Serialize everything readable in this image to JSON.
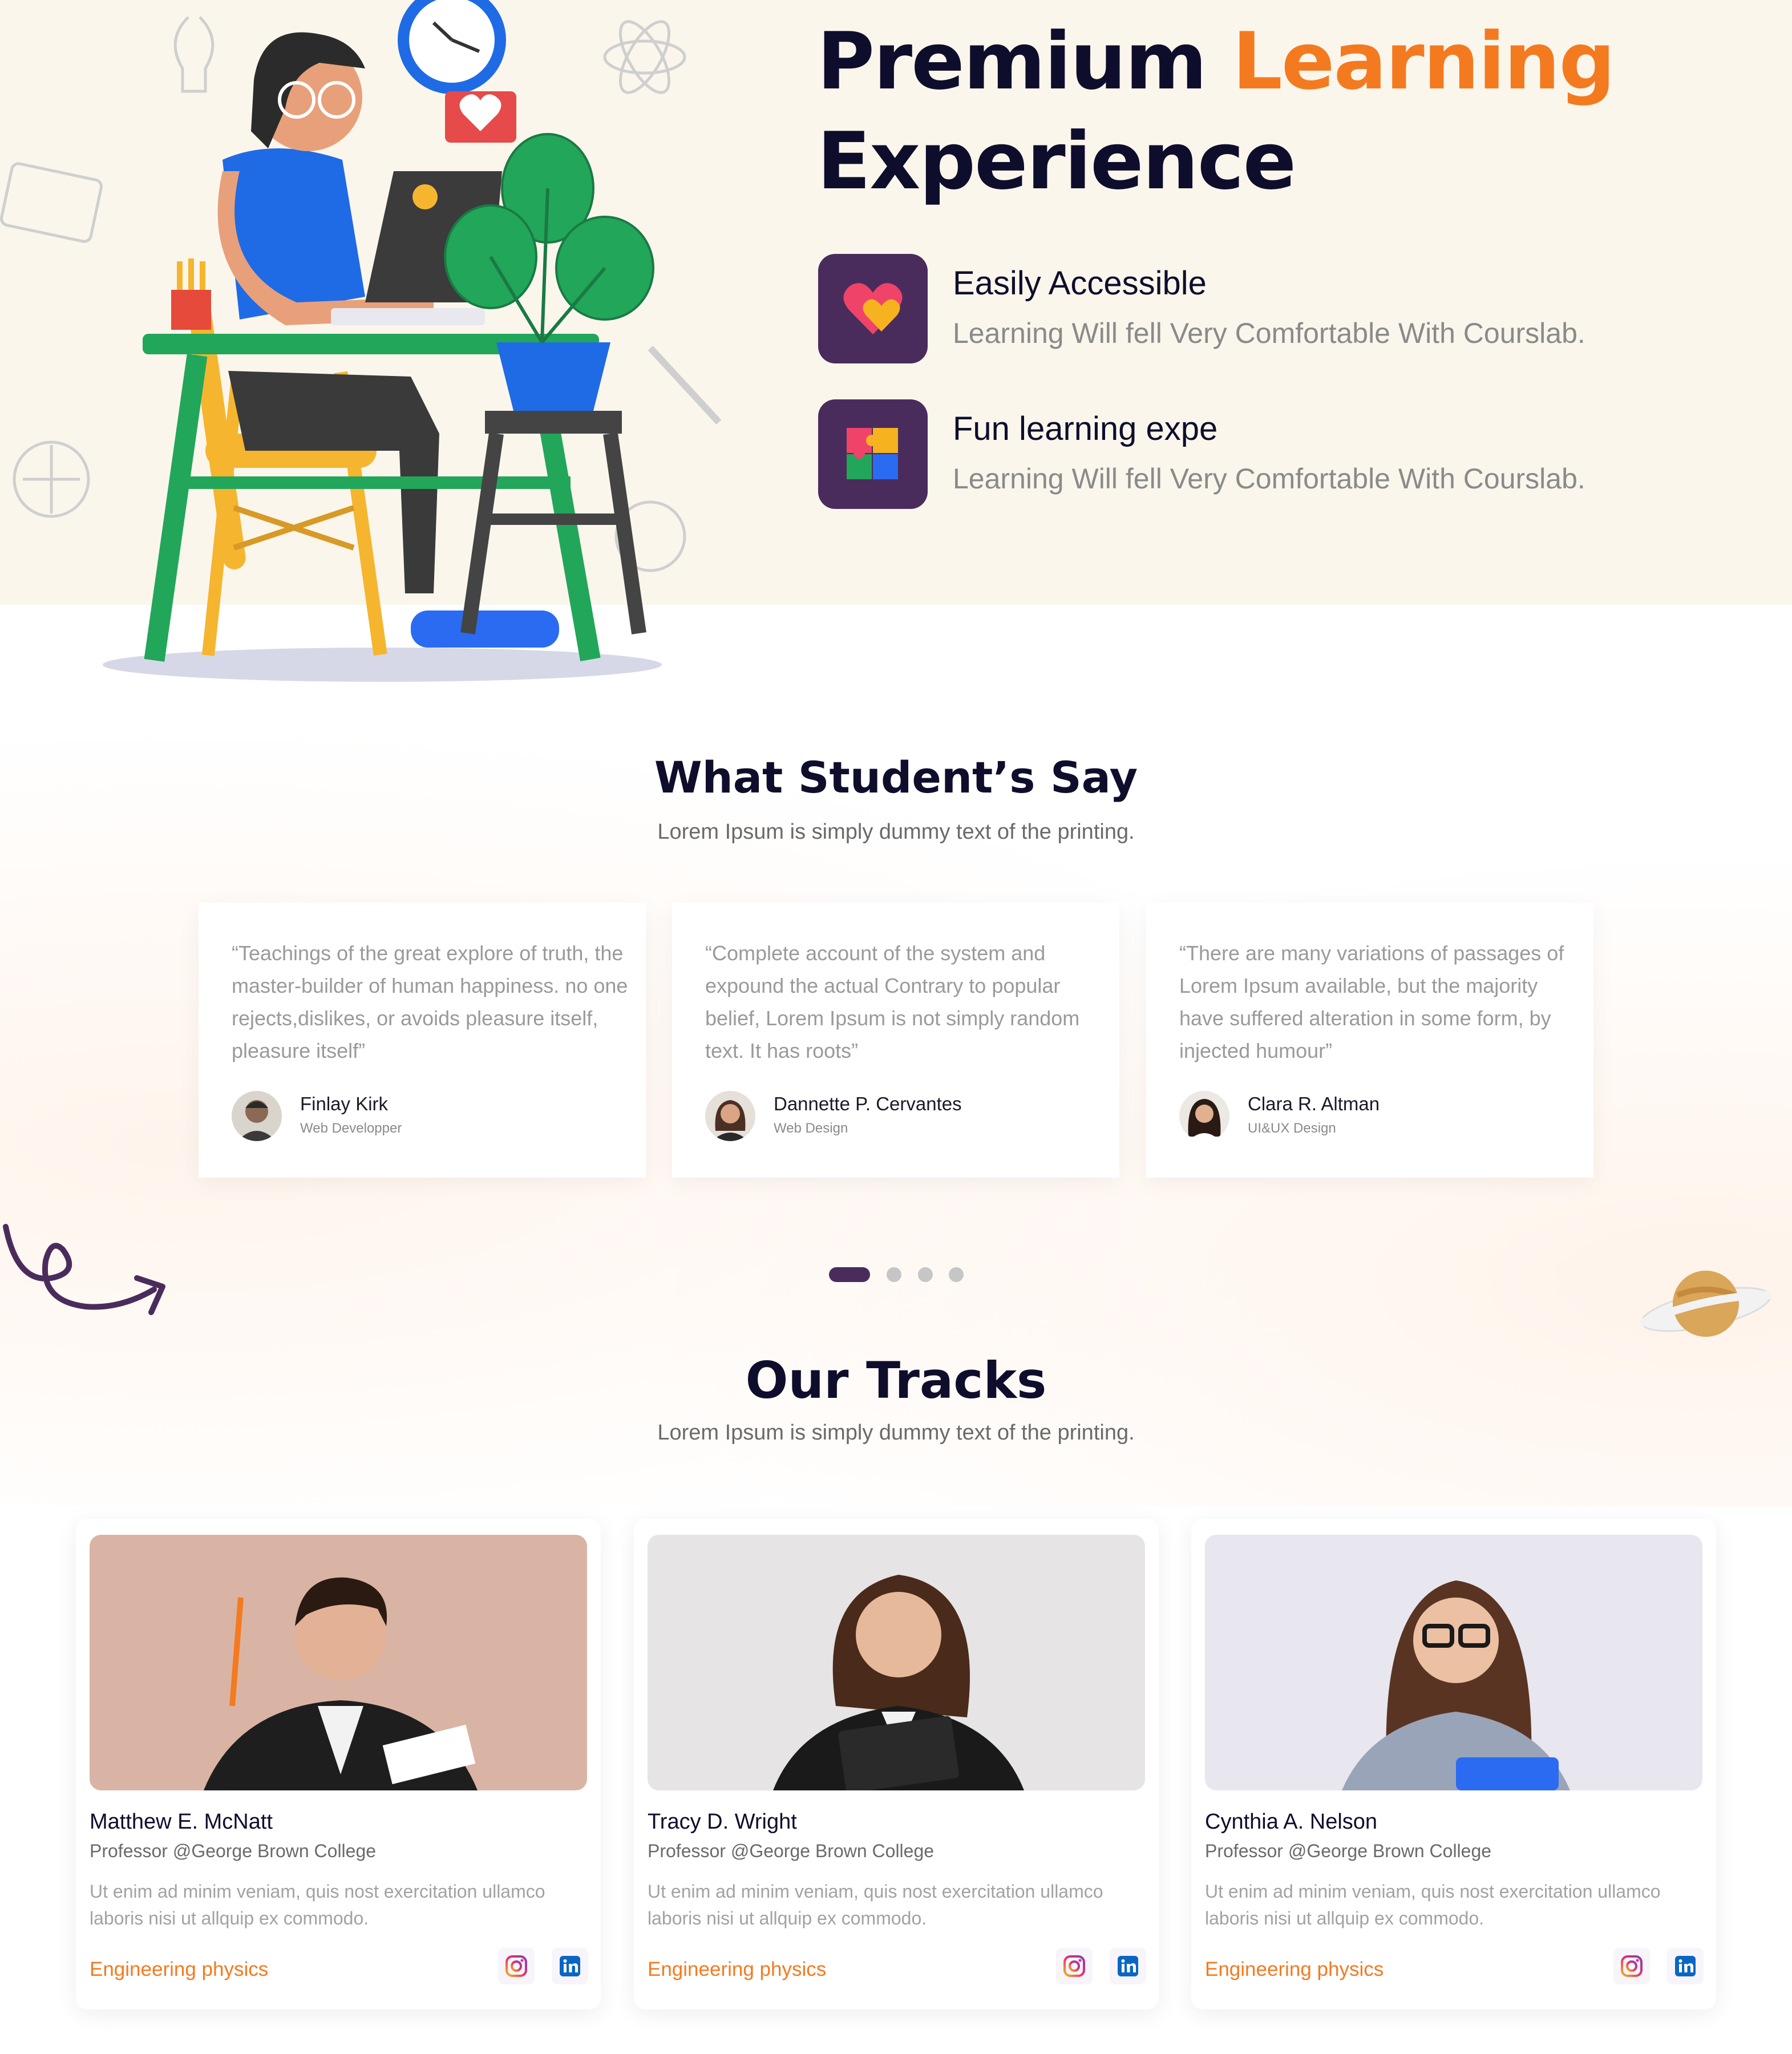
{
  "hero": {
    "title_part1": "Premium ",
    "title_accent": "Learning",
    "title_part2": "Experience",
    "features": [
      {
        "icon": "heart-icon",
        "title": "Easily Accessible",
        "description": "Learning Will fell Very Comfortable With Courslab."
      },
      {
        "icon": "puzzle-icon",
        "title": "Fun learning expe",
        "description": "Learning Will fell Very Comfortable With Courslab."
      }
    ]
  },
  "testimonials": {
    "title": "What Student’s Say",
    "subtitle": "Lorem Ipsum is simply dummy text of the printing.",
    "items": [
      {
        "quote": "“Teachings of the great explore of truth, the master-builder of human happiness. no one rejects,dislikes, or avoids pleasure itself, pleasure itself”",
        "name": "Finlay Kirk",
        "role": "Web Developper"
      },
      {
        "quote": "“Complete account of the system and expound the actual Contrary to popular belief, Lorem Ipsum is not simply random text. It has roots”",
        "name": "Dannette P. Cervantes",
        "role": "Web Design"
      },
      {
        "quote": "“There are many variations of passages of Lorem Ipsum available, but the majority have suffered alteration in some form, by injected humour”",
        "name": "Clara R. Altman",
        "role": "UI&UX Design"
      }
    ],
    "pagination": {
      "count": 4,
      "active": 1
    }
  },
  "tracks": {
    "title": "Our Tracks",
    "subtitle": "Lorem Ipsum is simply dummy text of the printing.",
    "items": [
      {
        "name": "Matthew E. McNatt",
        "title": "Professor @George Brown College",
        "description": "Ut enim ad minim veniam, quis nost exercitation ullamco laboris nisi ut allquip ex commodo.",
        "track": "Engineering physics"
      },
      {
        "name": "Tracy D. Wright",
        "title": "Professor @George Brown College",
        "description": "Ut enim ad minim veniam, quis nost exercitation ullamco laboris nisi ut allquip ex commodo.",
        "track": "Engineering physics"
      },
      {
        "name": "Cynthia A. Nelson",
        "title": "Professor @George Brown College",
        "description": "Ut enim ad minim veniam, quis nost exercitation ullamco laboris nisi ut allquip ex commodo.",
        "track": "Engineering physics"
      }
    ]
  },
  "colors": {
    "accent": "#f47a20",
    "primary": "#4a2c5c",
    "hero_bg": "#fbf6ec",
    "heading": "#0e0e2c"
  },
  "icons": {
    "social": [
      "instagram-icon",
      "linkedin-icon"
    ],
    "decorations": [
      "curly-arrow-icon",
      "planet-icon"
    ]
  }
}
